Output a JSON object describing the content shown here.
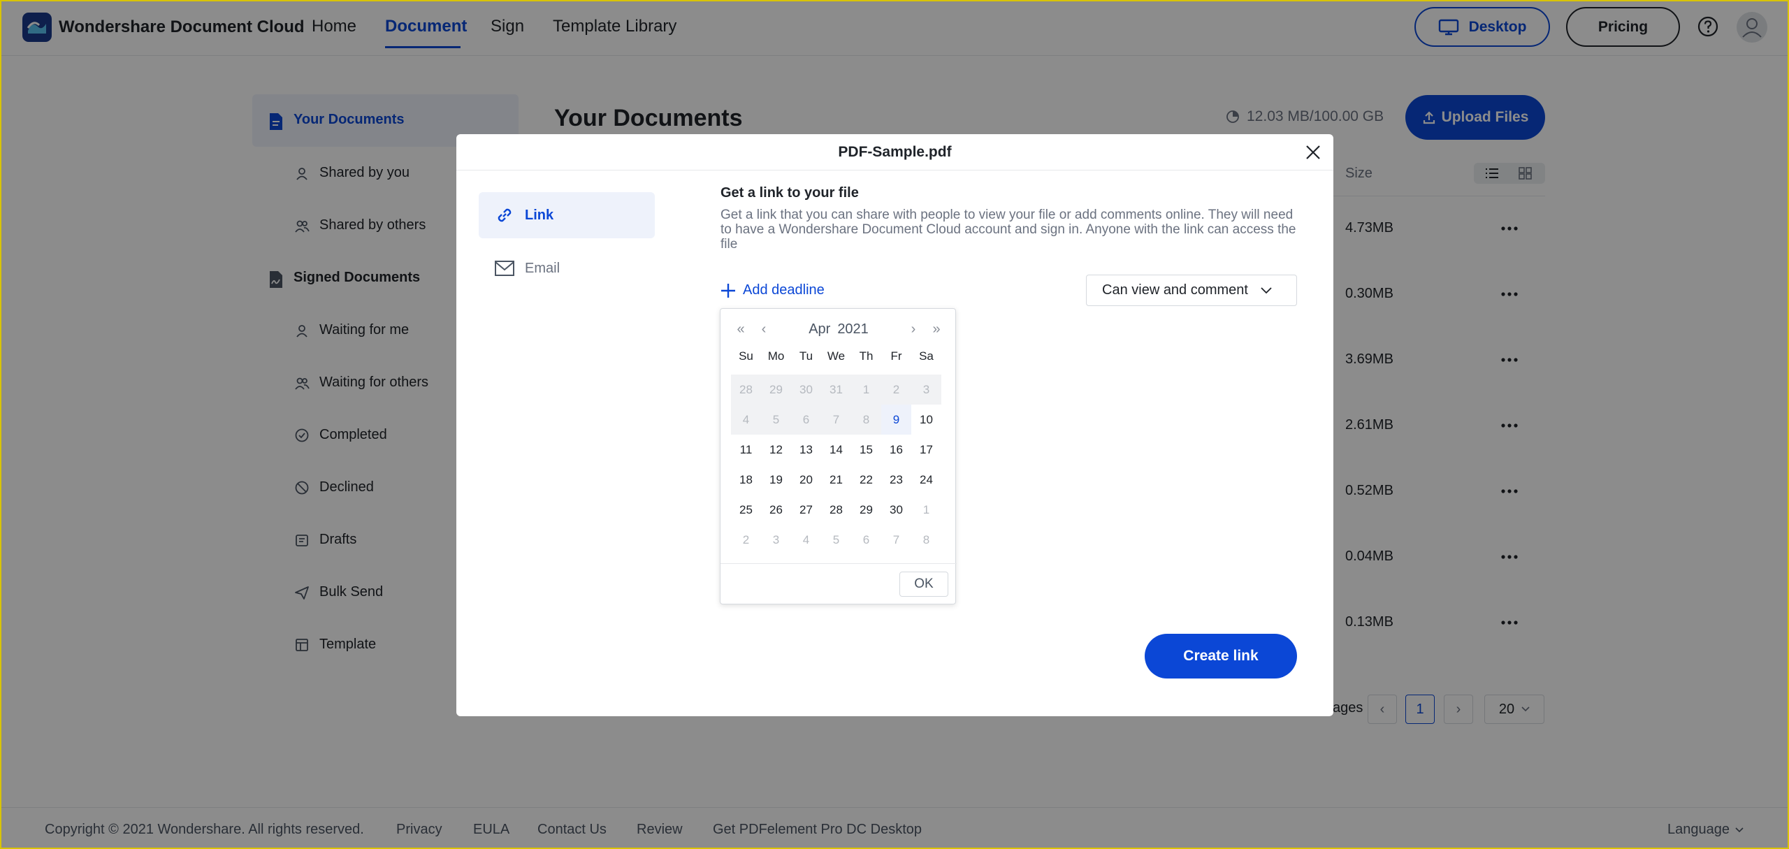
{
  "header": {
    "brand": "Wondershare Document Cloud",
    "nav": [
      "Home",
      "Document",
      "Sign",
      "Template Library"
    ],
    "active_nav": "Document",
    "desktop_label": "Desktop",
    "pricing_label": "Pricing"
  },
  "sidebar": {
    "items": [
      {
        "label": "Your Documents",
        "icon": "document-icon",
        "main": true,
        "active": true
      },
      {
        "label": "Shared by you",
        "icon": "user-icon"
      },
      {
        "label": "Shared by others",
        "icon": "users-icon"
      },
      {
        "label": "Signed Documents",
        "icon": "signature-icon",
        "main": true
      },
      {
        "label": "Waiting for me",
        "icon": "user-icon"
      },
      {
        "label": "Waiting for others",
        "icon": "users-icon"
      },
      {
        "label": "Completed",
        "icon": "check-circle-icon"
      },
      {
        "label": "Declined",
        "icon": "block-icon"
      },
      {
        "label": "Drafts",
        "icon": "draft-icon"
      },
      {
        "label": "Bulk Send",
        "icon": "send-icon"
      },
      {
        "label": "Template",
        "icon": "template-icon"
      }
    ]
  },
  "main": {
    "title": "Your Documents",
    "storage": "12.03 MB/100.00 GB",
    "upload_label": "Upload Files",
    "size_header": "Size",
    "sizes": [
      "4.73MB",
      "0.30MB",
      "3.69MB",
      "2.61MB",
      "0.52MB",
      "0.04MB",
      "0.13MB"
    ],
    "pager": {
      "label_fragment": "ages",
      "current_page": "1",
      "per_page": "20"
    }
  },
  "footer": {
    "copyright": "Copyright © 2021 Wondershare. All rights reserved.",
    "links": [
      "Privacy",
      "EULA",
      "Contact Us",
      "Review",
      "Get PDFelement Pro DC Desktop"
    ],
    "language": "Language"
  },
  "modal": {
    "title": "PDF-Sample.pdf",
    "tabs": [
      {
        "label": "Link",
        "icon": "link-icon",
        "active": true
      },
      {
        "label": "Email",
        "icon": "mail-icon"
      }
    ],
    "heading": "Get a link to your file",
    "description": "Get a link that you can share with people to view your file or add comments online. They will need to have a Wondershare Document Cloud account and sign in. Anyone with the link can access the file",
    "add_deadline": "Add deadline",
    "permission": "Can view and comment",
    "create_link": "Create link"
  },
  "calendar": {
    "month": "Apr",
    "year": "2021",
    "weekdays": [
      "Su",
      "Mo",
      "Tu",
      "We",
      "Th",
      "Fr",
      "Sa"
    ],
    "weeks": [
      [
        "28",
        "29",
        "30",
        "31",
        "1",
        "2",
        "3"
      ],
      [
        "4",
        "5",
        "6",
        "7",
        "8",
        "9",
        "10"
      ],
      [
        "11",
        "12",
        "13",
        "14",
        "15",
        "16",
        "17"
      ],
      [
        "18",
        "19",
        "20",
        "21",
        "22",
        "23",
        "24"
      ],
      [
        "25",
        "26",
        "27",
        "28",
        "29",
        "30",
        "1"
      ],
      [
        "2",
        "3",
        "4",
        "5",
        "6",
        "7",
        "8"
      ]
    ],
    "today": "9",
    "ok_label": "OK"
  },
  "colors": {
    "accent": "#0b47d6",
    "overlay": "rgba(0,0,0,0.45)"
  }
}
